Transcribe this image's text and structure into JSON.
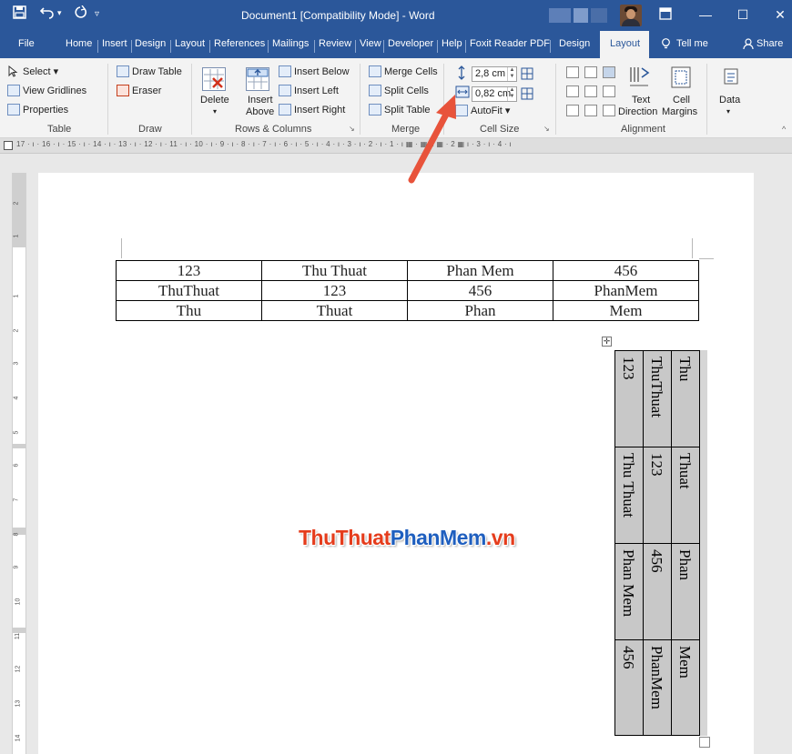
{
  "window": {
    "title": "Document1 [Compatibility Mode]  -  Word",
    "save_icon": "save-icon",
    "undo_icon": "undo-icon",
    "redo_icon": "redo-icon",
    "qat_icon": "customize-quick-access-icon",
    "ribbon_display_icon": "ribbon-display-icon",
    "minimize_glyph": "—",
    "maximize_glyph": "☐",
    "close_glyph": "✕"
  },
  "tabs": [
    {
      "label": "File"
    },
    {
      "label": "Home"
    },
    {
      "label": "Insert"
    },
    {
      "label": "Design"
    },
    {
      "label": "Layout"
    },
    {
      "label": "References"
    },
    {
      "label": "Mailings"
    },
    {
      "label": "Review"
    },
    {
      "label": "View"
    },
    {
      "label": "Developer"
    },
    {
      "label": "Help"
    },
    {
      "label": "Foxit Reader PDF"
    },
    {
      "label": "Design"
    },
    {
      "label": "Layout",
      "active": true
    },
    {
      "label": "Tell me"
    },
    {
      "label": "Share"
    }
  ],
  "ribbon": {
    "table_group": {
      "select": "Select ▾",
      "view_gridlines": "View Gridlines",
      "properties": "Properties",
      "label": "Table"
    },
    "draw_group": {
      "draw_table": "Draw Table",
      "eraser": "Eraser",
      "label": "Draw"
    },
    "rows_columns_group": {
      "delete": "Delete",
      "delete_arrow": "▾",
      "insert_above_1": "Insert",
      "insert_above_2": "Above",
      "insert_below": "Insert Below",
      "insert_left": "Insert Left",
      "insert_right": "Insert Right",
      "label": "Rows & Columns"
    },
    "merge_group": {
      "merge_cells": "Merge Cells",
      "split_cells": "Split Cells",
      "split_table": "Split Table",
      "label": "Merge"
    },
    "cell_size_group": {
      "height_value": "2,8 cm",
      "width_value": "0,82 cm",
      "autofit": "AutoFit ▾",
      "label": "Cell Size"
    },
    "alignment_group": {
      "text_direction_1": "Text",
      "text_direction_2": "Direction",
      "cell_margins_1": "Cell",
      "cell_margins_2": "Margins",
      "label": "Alignment"
    },
    "data_group": {
      "data": "Data",
      "data_arrow": "▾"
    }
  },
  "ruler": {
    "horizontal_text": "17 · ı · 16 · ı · 15 · ı · 14 · ı · 13 · ı · 12 · ı · 11 · ı · 10 · ı · 9 · ı · 8 · ı · 7 · ı · 6 · ı · 5 · ı · 4 · ı · 3 · ı · 2 · ı · 1 · ı ▦ · ▦ 1 ▦ · 2 ▦ ı · 3 · ı · 4 · ı",
    "vertical_numbers": [
      "2",
      "1",
      "1",
      "2",
      "3",
      "4",
      "5",
      "6",
      "7",
      "8",
      "9",
      "10",
      "11",
      "12",
      "13",
      "14"
    ]
  },
  "horizontal_table": {
    "rows": [
      [
        "123",
        "Thu Thuat",
        "Phan Mem",
        "456"
      ],
      [
        "ThuThuat",
        "123",
        "456",
        "PhanMem"
      ],
      [
        "Thu",
        "Thuat",
        "Phan",
        "Mem"
      ]
    ]
  },
  "vertical_table": {
    "columns": [
      [
        "123",
        "Thu Thuat",
        "Phan Mem",
        "456"
      ],
      [
        "ThuThuat",
        "123",
        "456",
        "PhanMem"
      ],
      [
        "Thu",
        "Thuat",
        "Phan",
        "Mem"
      ]
    ],
    "move_handle_glyph": "✛"
  },
  "watermark": {
    "part1": "ThuThuat",
    "part2": "PhanMem",
    "part3": ".vn"
  },
  "colors": {
    "title_bar": "#2b579a",
    "arrow": "#e8533b"
  }
}
